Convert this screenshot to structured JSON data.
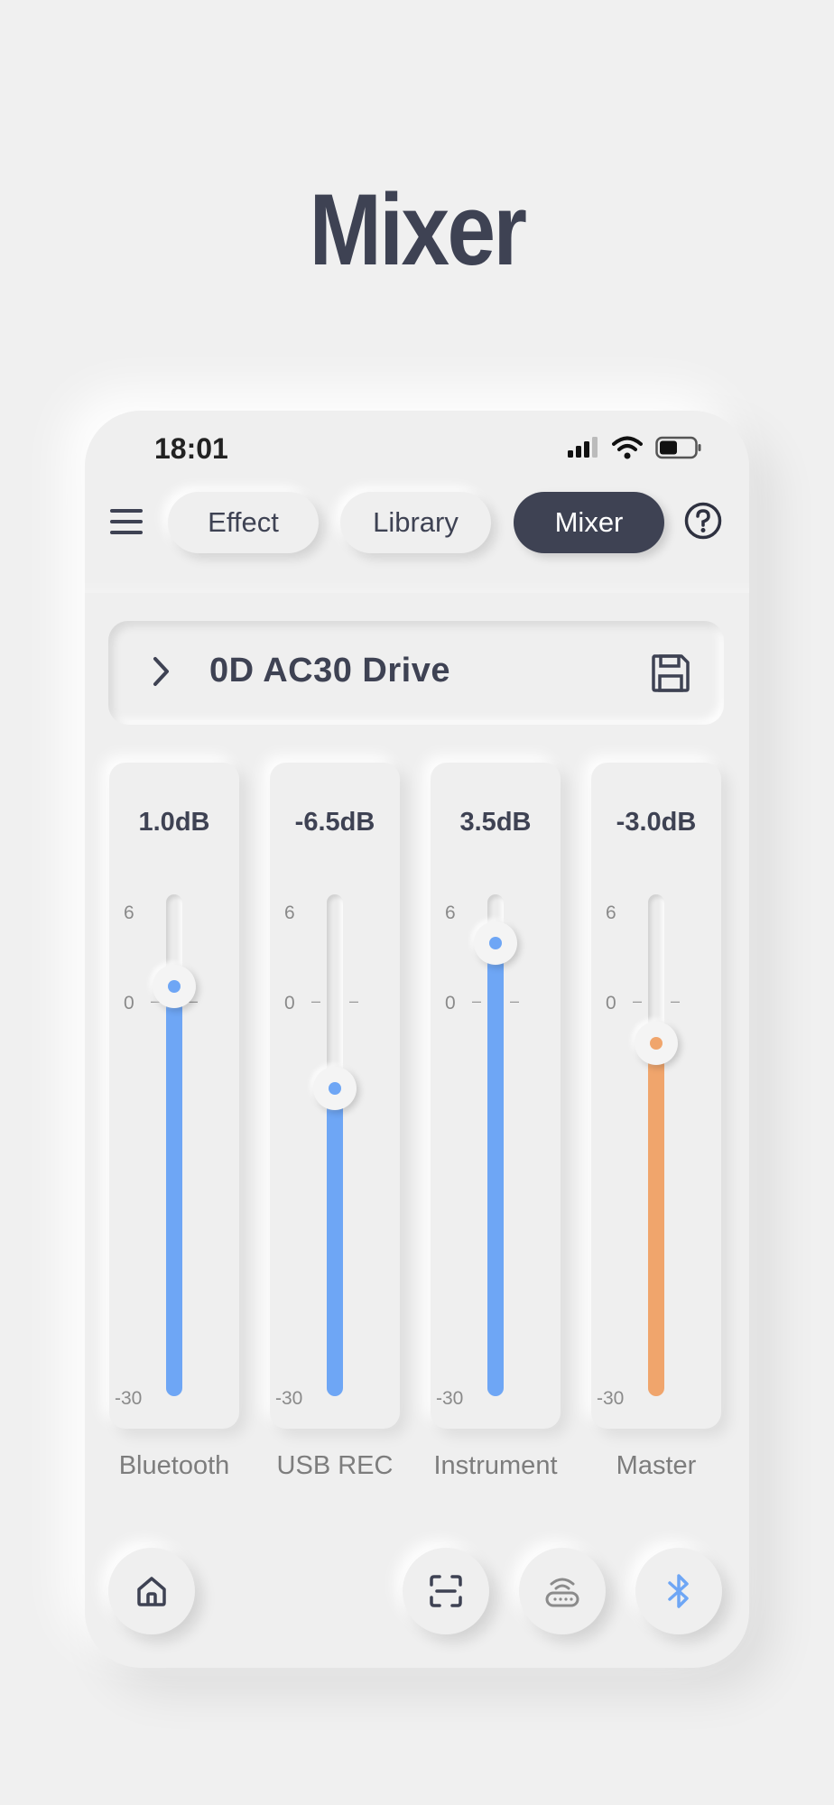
{
  "page_title": "Mixer",
  "status": {
    "time": "18:01"
  },
  "tabs": [
    {
      "label": "Effect",
      "active": false
    },
    {
      "label": "Library",
      "active": false
    },
    {
      "label": "Mixer",
      "active": true
    }
  ],
  "preset": {
    "name": "0D AC30 Drive"
  },
  "scale": {
    "max": "6",
    "mid": "0",
    "min": "-30"
  },
  "channels": [
    {
      "label": "Bluetooth",
      "value_text": "1.0dB",
      "value_db": 1.0,
      "color": "#6ea6f5"
    },
    {
      "label": "USB REC",
      "value_text": "-6.5dB",
      "value_db": -6.5,
      "color": "#6ea6f5"
    },
    {
      "label": "Instrument",
      "value_text": "3.5dB",
      "value_db": 3.5,
      "color": "#6ea6f5"
    },
    {
      "label": "Master",
      "value_text": "-3.0dB",
      "value_db": -3.0,
      "color": "#f0a56c"
    }
  ],
  "icons": {
    "menu": "hamburger-menu-icon",
    "help": "help-circle-icon",
    "chevron": "chevron-right-icon",
    "save": "floppy-disk-icon",
    "home": "home-icon",
    "scan": "scan-icon",
    "router": "router-icon",
    "bluetooth": "bluetooth-icon"
  },
  "accent_colors": {
    "dark": "#3e4253",
    "blue": "#6ea6f5",
    "orange": "#f0a56c"
  }
}
